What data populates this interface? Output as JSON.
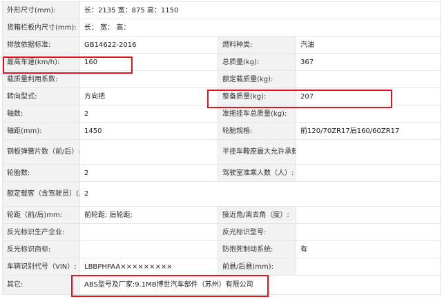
{
  "rows": [
    {
      "l1": "外形尺寸(mm):",
      "v1": "长：2135 宽：875 高：1150"
    },
    {
      "l1": "货箱栏板内尺寸(mm):",
      "v1": "长：  宽：  高："
    },
    {
      "l1": "排放依据标准:",
      "v1": "GB14622-2016",
      "l2": "燃料种类:",
      "v2": "汽油"
    },
    {
      "l1": "最高车速(km/h):",
      "v1": "160",
      "l2": "总质量(kg):",
      "v2": "367"
    },
    {
      "l1": "载质量利用系数:",
      "v1": "",
      "l2": "额定载质量(kg):",
      "v2": ""
    },
    {
      "l1": "转向型式:",
      "v1": "方向把",
      "l2": "整备质量(kg):",
      "v2": "207"
    },
    {
      "l1": "轴数:",
      "v1": "2",
      "l2": "准拖挂车总质量(kg):",
      "v2": ""
    },
    {
      "l1": "轴距(mm):",
      "v1": "1450",
      "l2": "轮胎规格:",
      "v2": "前120/70ZR17后160/60ZR17"
    },
    {
      "l1": "钢板弹簧片数（前/后）:",
      "v1": "",
      "l2": "半挂车鞍座最大允许承载质量(kg):",
      "v2": ""
    },
    {
      "l1": "轮胎数:",
      "v1": "2",
      "l2": "驾驶室准乘人数（人）:",
      "v2": ""
    },
    {
      "l1": "额定载客（含驾驶员）(座位数):",
      "v1": "2"
    },
    {
      "l1": "轮距（前/后)mm:",
      "v1": "前轮距: 后轮距:",
      "l2": "接近角/离去角（度）:",
      "v2": ""
    },
    {
      "l1": "反光标识生产企业:",
      "v1": "",
      "l2": "反光标识型号:",
      "v2": ""
    },
    {
      "l1": "反光标识商标:",
      "v1": "",
      "l2": "防抱死制动系统:",
      "v2": "有"
    },
    {
      "l1": "车辆识别代号（VIN）:",
      "v1": "LBBPHPAA×××××××××",
      "l2": "前悬/后悬(mm):",
      "v2": ""
    },
    {
      "l1": "其它:",
      "v1": "ABS型号及厂家:9.1MB博世汽车部件（苏州）有限公司"
    }
  ],
  "colors": {
    "highlight": "#e0141e",
    "label_bg": "#f2f2f2",
    "border": "#e6e6e6"
  }
}
